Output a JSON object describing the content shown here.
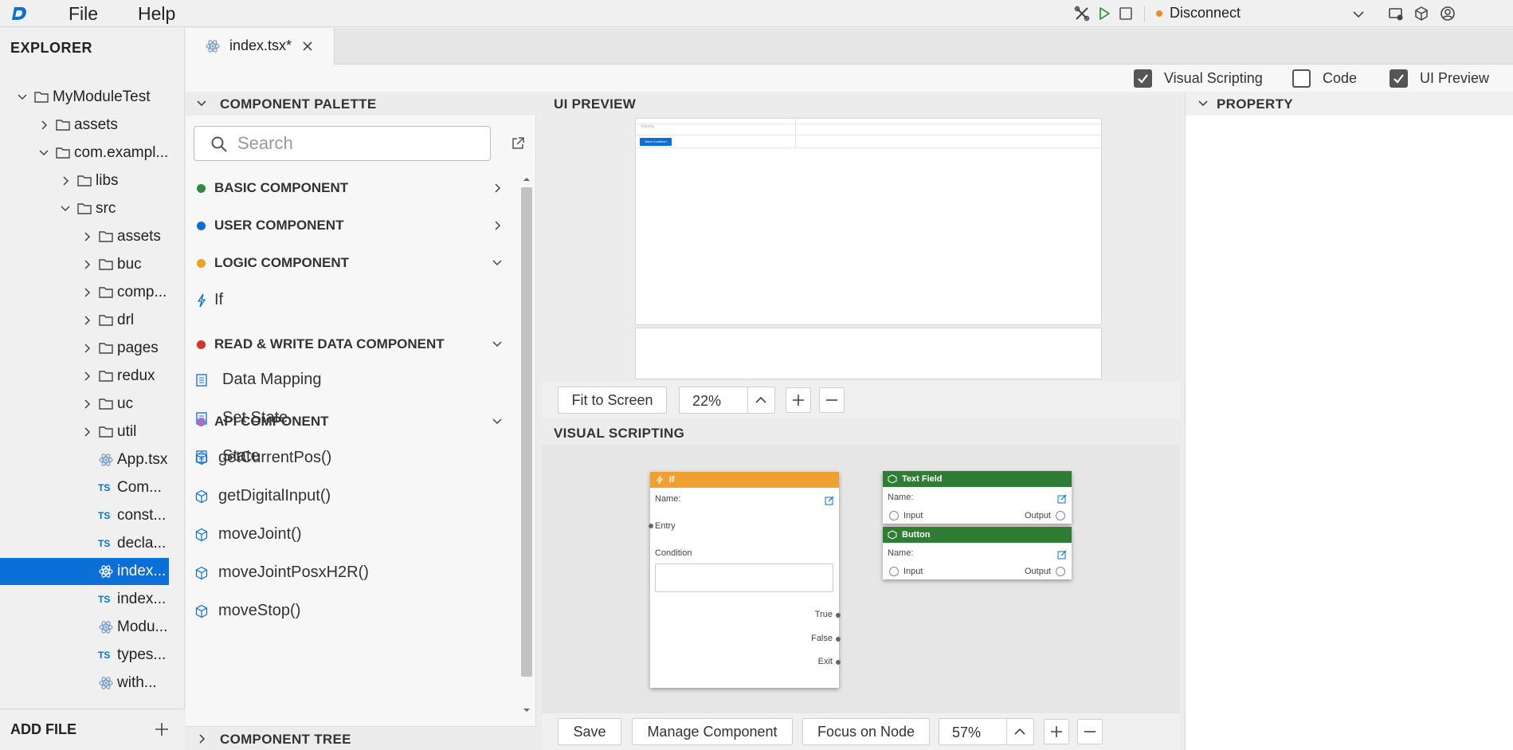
{
  "menubar": {
    "file": "File",
    "help": "Help",
    "connection_label": "Disconnect",
    "connection_status_color": "#f08c1e",
    "icons": [
      "tools-icon",
      "play-icon",
      "stop-icon",
      "chevron-down-icon",
      "device-icon",
      "cube-icon",
      "account-icon"
    ]
  },
  "explorer": {
    "title": "EXPLORER",
    "items": [
      {
        "label": "MyModuleTest",
        "type": "folder",
        "expanded": true
      },
      {
        "label": "assets",
        "type": "folder",
        "expanded": false
      },
      {
        "label": "com.exampl...",
        "type": "folder",
        "expanded": true
      },
      {
        "label": "libs",
        "type": "folder",
        "expanded": false
      },
      {
        "label": "src",
        "type": "folder",
        "expanded": true
      },
      {
        "label": "assets",
        "type": "folder",
        "expanded": false
      },
      {
        "label": "buc",
        "type": "folder",
        "expanded": false
      },
      {
        "label": "comp...",
        "type": "folder",
        "expanded": false
      },
      {
        "label": "drl",
        "type": "folder",
        "expanded": false
      },
      {
        "label": "pages",
        "type": "folder",
        "expanded": false
      },
      {
        "label": "redux",
        "type": "folder",
        "expanded": false
      },
      {
        "label": "uc",
        "type": "folder",
        "expanded": false
      },
      {
        "label": "util",
        "type": "folder",
        "expanded": false
      },
      {
        "label": "App.tsx",
        "type": "react"
      },
      {
        "label": "Com...",
        "type": "ts"
      },
      {
        "label": "const...",
        "type": "ts"
      },
      {
        "label": "decla...",
        "type": "ts"
      },
      {
        "label": "index...",
        "type": "react",
        "selected": true
      },
      {
        "label": "index...",
        "type": "ts"
      },
      {
        "label": "Modu...",
        "type": "react"
      },
      {
        "label": "types...",
        "type": "ts"
      },
      {
        "label": "with...",
        "type": "react"
      }
    ],
    "ts_badge": "TS",
    "add_file": "ADD FILE"
  },
  "tabs": [
    {
      "label": "index.tsx*",
      "active": true
    }
  ],
  "view_toggles": [
    {
      "label": "Visual Scripting",
      "checked": true
    },
    {
      "label": "Code",
      "checked": false
    },
    {
      "label": "UI Preview",
      "checked": true
    }
  ],
  "palette": {
    "title": "COMPONENT PALETTE",
    "search_placeholder": "Search",
    "categories": [
      {
        "label": "BASIC COMPONENT",
        "color": "#2e8b3e",
        "expanded": false,
        "items": []
      },
      {
        "label": "USER COMPONENT",
        "color": "#0a6fd6",
        "expanded": false,
        "items": []
      },
      {
        "label": "LOGIC COMPONENT",
        "color": "#f0a020",
        "expanded": true,
        "items": [
          "If"
        ]
      },
      {
        "label": "READ & WRITE DATA COMPONENT",
        "color": "#d93030",
        "expanded": true,
        "items": [
          "Data Mapping",
          "Set State",
          "State"
        ]
      },
      {
        "label": "API COMPONENT",
        "color": "#a070c8",
        "expanded": true,
        "items": [
          "getCurrentPos()",
          "getDigitalInput()",
          "moveJoint()",
          "moveJointPosxH2R()",
          "moveStop()"
        ]
      }
    ],
    "tree_title": "COMPONENT TREE"
  },
  "preview": {
    "title": "UI PREVIEW",
    "canvas_text": "Velocity",
    "canvas_button": "Save Condition",
    "fit_label": "Fit to Screen",
    "zoom": "22%"
  },
  "visual_scripting": {
    "title": "VISUAL SCRIPTING",
    "nodes": [
      {
        "title": "If",
        "color": "#f0a030",
        "name_label": "Name:",
        "entry": "Entry",
        "condition": "Condition",
        "outputs": [
          "True",
          "False",
          "Exit"
        ]
      },
      {
        "title": "Text Field",
        "color": "#2e7d32",
        "name_label": "Name:",
        "input": "Input",
        "output": "Output"
      },
      {
        "title": "Button",
        "color": "#2e7d32",
        "name_label": "Name:",
        "input": "Input",
        "output": "Output"
      }
    ],
    "save_label": "Save",
    "manage_label": "Manage Component",
    "focus_label": "Focus on Node",
    "zoom": "57%"
  },
  "property": {
    "title": "PROPERTY"
  }
}
